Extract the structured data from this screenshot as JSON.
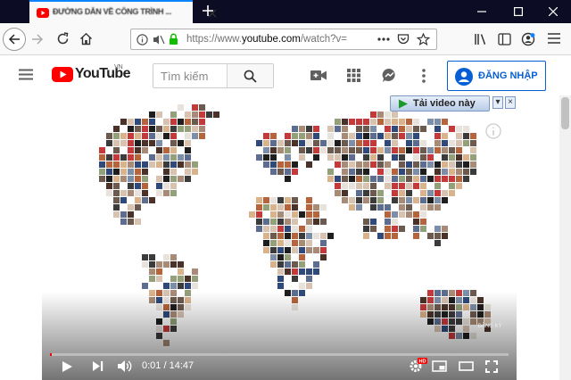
{
  "browser": {
    "tab_title": "ĐƯỜNG DẪN VỀ CÔNG TRÌNH ...",
    "url_prefix": "https://www.",
    "url_domain": "youtube.com",
    "url_path": "/watch?v="
  },
  "youtube": {
    "logo_text": "YouTube",
    "country_code": "VN",
    "search_placeholder": "Tìm kiếm",
    "signin_label": "ĐĂNG NHẬP"
  },
  "player": {
    "current_time": "0:01",
    "duration": "14:47",
    "time_separator": " / ",
    "progress": 0.001,
    "hd_badge": "HD",
    "watermark": "ĐĂNG KÝ"
  },
  "download_bar": {
    "label": "Tải video này",
    "option_button": "▾",
    "close_button": "×"
  },
  "colors": {
    "tabbar": "#0c0c24",
    "accent": "#0a84ff",
    "youtube_red": "#ff0000",
    "signin_blue": "#065fd4"
  }
}
